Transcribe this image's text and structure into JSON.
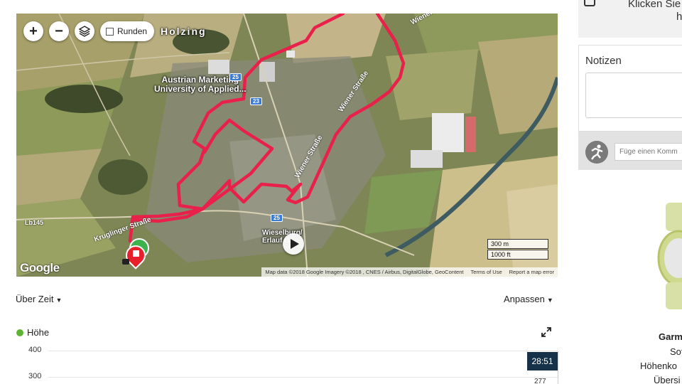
{
  "map": {
    "controls": {
      "zoom_in": "+",
      "zoom_out": "−",
      "laps_label": "Runden"
    },
    "place_labels": {
      "holzing": "Holzing",
      "amu_line1": "Austrian Marketing",
      "amu_line2": "University of Applied...",
      "wieselburg_line1": "Wieselburg/",
      "wieselburg_line2": "Erlauf B..."
    },
    "road_labels": {
      "wiener1": "Wiener Straße",
      "wiener2": "Wiener Straße",
      "wiener3": "Wiener Straße",
      "kruglinger": "Kruglinger Straße",
      "lb": "Lb145"
    },
    "road_shields": {
      "a": "23",
      "b": "25",
      "c": "25"
    },
    "scale": {
      "metric": "300 m",
      "imperial": "1000 ft"
    },
    "google": "Google",
    "attribution": {
      "data": "Map data ©2018 Google Imagery ©2018 , CNES / Airbus, DigitalGlobe, GeoContent",
      "terms": "Terms of Use",
      "report": "Report a map error"
    },
    "route_color": "#e8204a"
  },
  "chart_controls": {
    "over_time": "Über Zeit",
    "adjust": "Anpassen"
  },
  "chart_data": {
    "type": "line",
    "series": [
      {
        "name": "Höhe",
        "color": "#5cb531"
      }
    ],
    "y_ticks": [
      "400",
      "300"
    ],
    "cursor_time": "28:51",
    "cursor_value": "277"
  },
  "sidebar": {
    "photo_prompt": "Klicken Sie",
    "photo_prompt_2": "h",
    "notes_title": "Notizen",
    "gear_placeholder": "Füge einen Komm",
    "device": {
      "line1": "Garm",
      "line2": "Sof",
      "line3": "Höhenko",
      "line4": "Übersi"
    }
  }
}
